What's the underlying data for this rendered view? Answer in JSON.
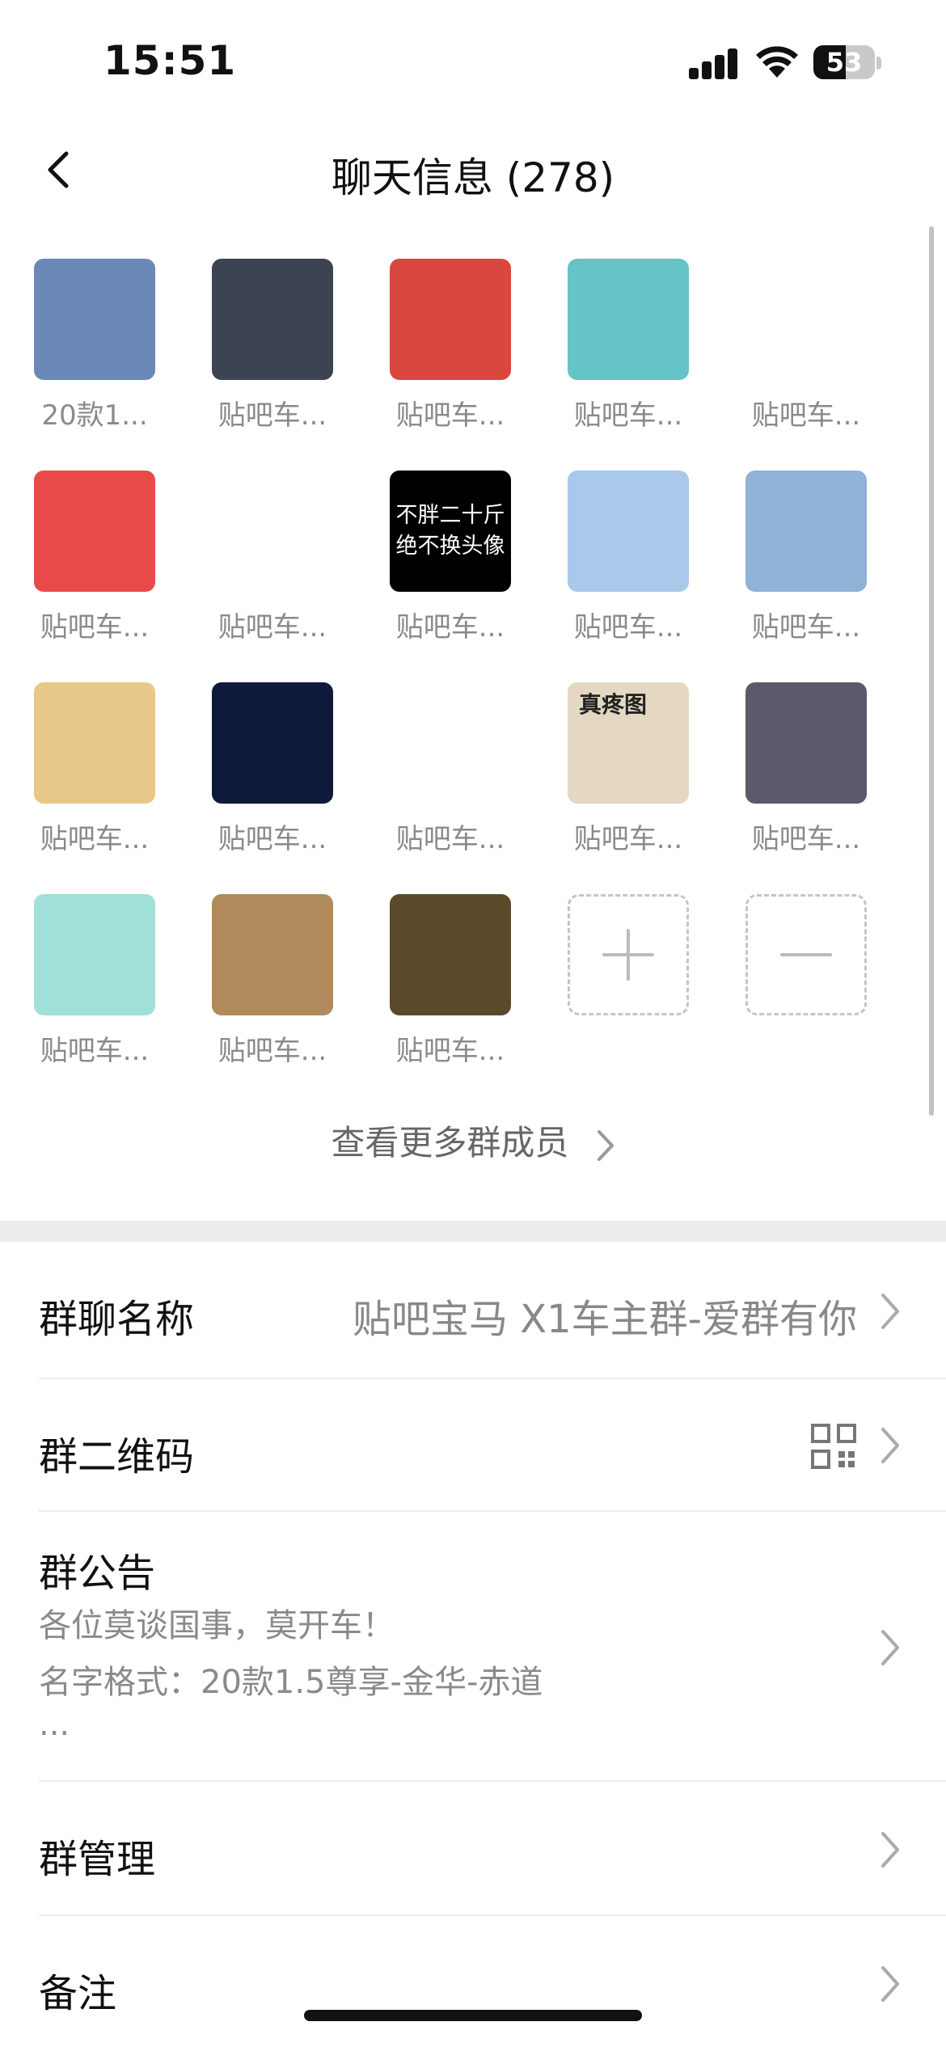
{
  "status_bar": {
    "time": "15:51",
    "battery": "53",
    "battery_level": 0.53
  },
  "nav": {
    "title": "聊天信息 (278)"
  },
  "members": [
    {
      "name": "20款1...",
      "avatar": "dusk-lamp-post-photo",
      "color": "#6a88b8"
    },
    {
      "name": "贴吧车...",
      "avatar": "person-dark-sky-photo",
      "color": "#3c4452"
    },
    {
      "name": "贴吧车...",
      "avatar": "anime-boy-flag-illustration",
      "color": "#d9473e"
    },
    {
      "name": "贴吧车...",
      "avatar": "cartoon-boy-goggles",
      "color": "#64c4c8"
    },
    {
      "name": "贴吧车...",
      "avatar": "none",
      "color": "#ffffff"
    },
    {
      "name": "贴吧车...",
      "avatar": "red-coat-back-illustration",
      "color": "#e84a4a"
    },
    {
      "name": "贴吧车...",
      "avatar": "running-cartoon-man",
      "color": "#ffffff"
    },
    {
      "name": "贴吧车...",
      "avatar": "text-avatar",
      "color": "#000000",
      "text_lines": [
        "不胖二十斤",
        "绝不换头像"
      ]
    },
    {
      "name": "贴吧车...",
      "avatar": "doraemon-pepsi-can",
      "color": "#a9c9ea"
    },
    {
      "name": "贴吧车...",
      "avatar": "clouds-airplane-window",
      "color": "#8fb2d6"
    },
    {
      "name": "贴吧车...",
      "avatar": "anime-blonde-girl",
      "color": "#e8c888"
    },
    {
      "name": "贴吧车...",
      "avatar": "night-sky-photo",
      "color": "#0f1a3a"
    },
    {
      "name": "贴吧车...",
      "avatar": "cartoon-couple",
      "color": "#ffffff"
    },
    {
      "name": "贴吧车...",
      "avatar": "tiger-meme",
      "color": "#e4d8c2",
      "text": "真疼图"
    },
    {
      "name": "贴吧车...",
      "avatar": "arch-silhouette-photo",
      "color": "#5a5a6a"
    },
    {
      "name": "贴吧车...",
      "avatar": "dinosaur-cartoon",
      "color": "#9fe0d8"
    },
    {
      "name": "贴吧车...",
      "avatar": "sunset-silhouette-photo",
      "color": "#b08a5a"
    },
    {
      "name": "贴吧车...",
      "avatar": "goku-illustration",
      "color": "#5a4a2a"
    }
  ],
  "more_members_label": "查看更多群成员",
  "settings": {
    "group_name_label": "群聊名称",
    "group_name_value": "贴吧宝马 X1车主群-爱群有你",
    "qr_label": "群二维码",
    "notice_label": "群公告",
    "notice_lines": [
      "各位莫谈国事，莫开车！",
      "名字格式：20款1.5尊享-金华-赤道",
      "..."
    ],
    "manage_label": "群管理",
    "remark_label": "备注"
  }
}
